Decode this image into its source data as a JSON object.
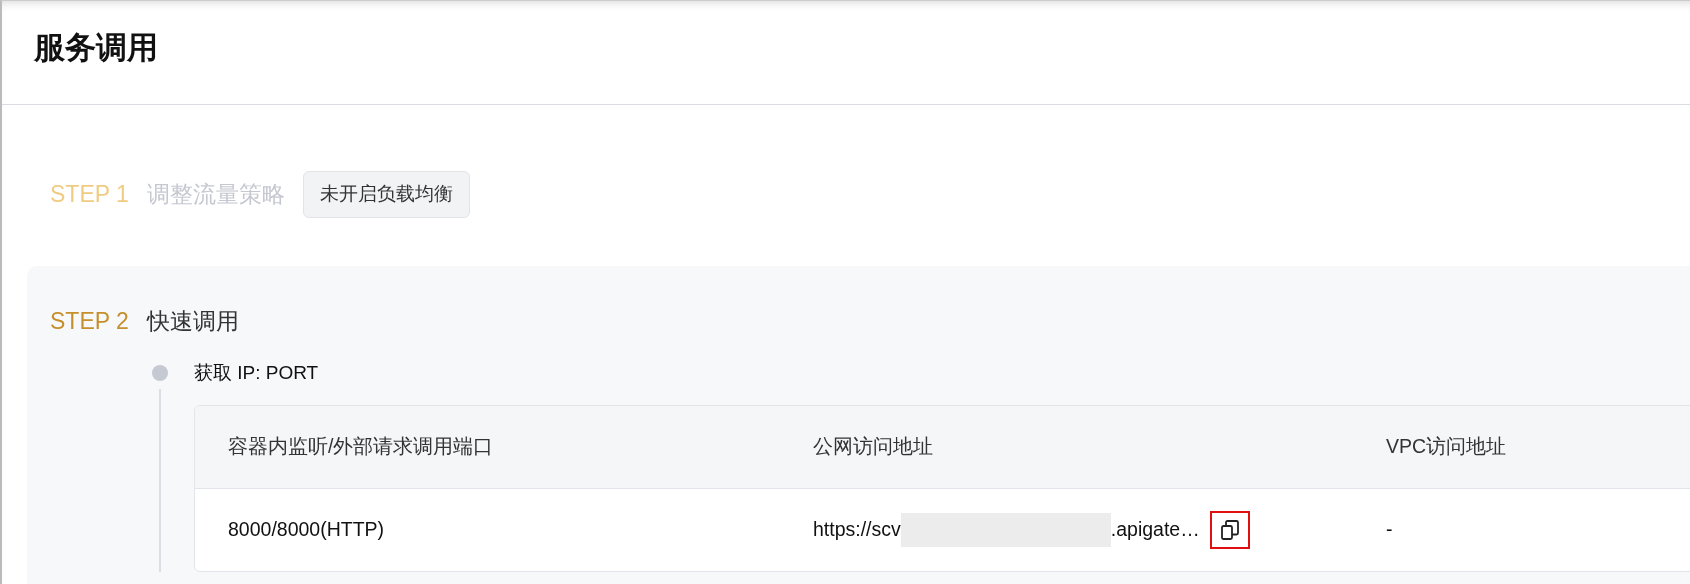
{
  "header": {
    "title": "服务调用"
  },
  "steps": [
    {
      "label": "STEP 1",
      "title": "调整流量策略",
      "disabled": true,
      "tag": "未开启负载均衡"
    },
    {
      "label": "STEP 2",
      "title": "快速调用",
      "disabled": false,
      "items": [
        {
          "title": "获取 IP: PORT",
          "table": {
            "columns": [
              "容器内监听/外部请求调用端口",
              "公网访问地址",
              "VPC访问地址"
            ],
            "rows": [
              {
                "port": "8000/8000(HTTP)",
                "public_url": {
                  "prefix": "https://scv",
                  "suffix": ".apigate…",
                  "redacted": true,
                  "copy_highlighted": true
                },
                "vpc": "-"
              }
            ]
          }
        }
      ]
    }
  ]
}
